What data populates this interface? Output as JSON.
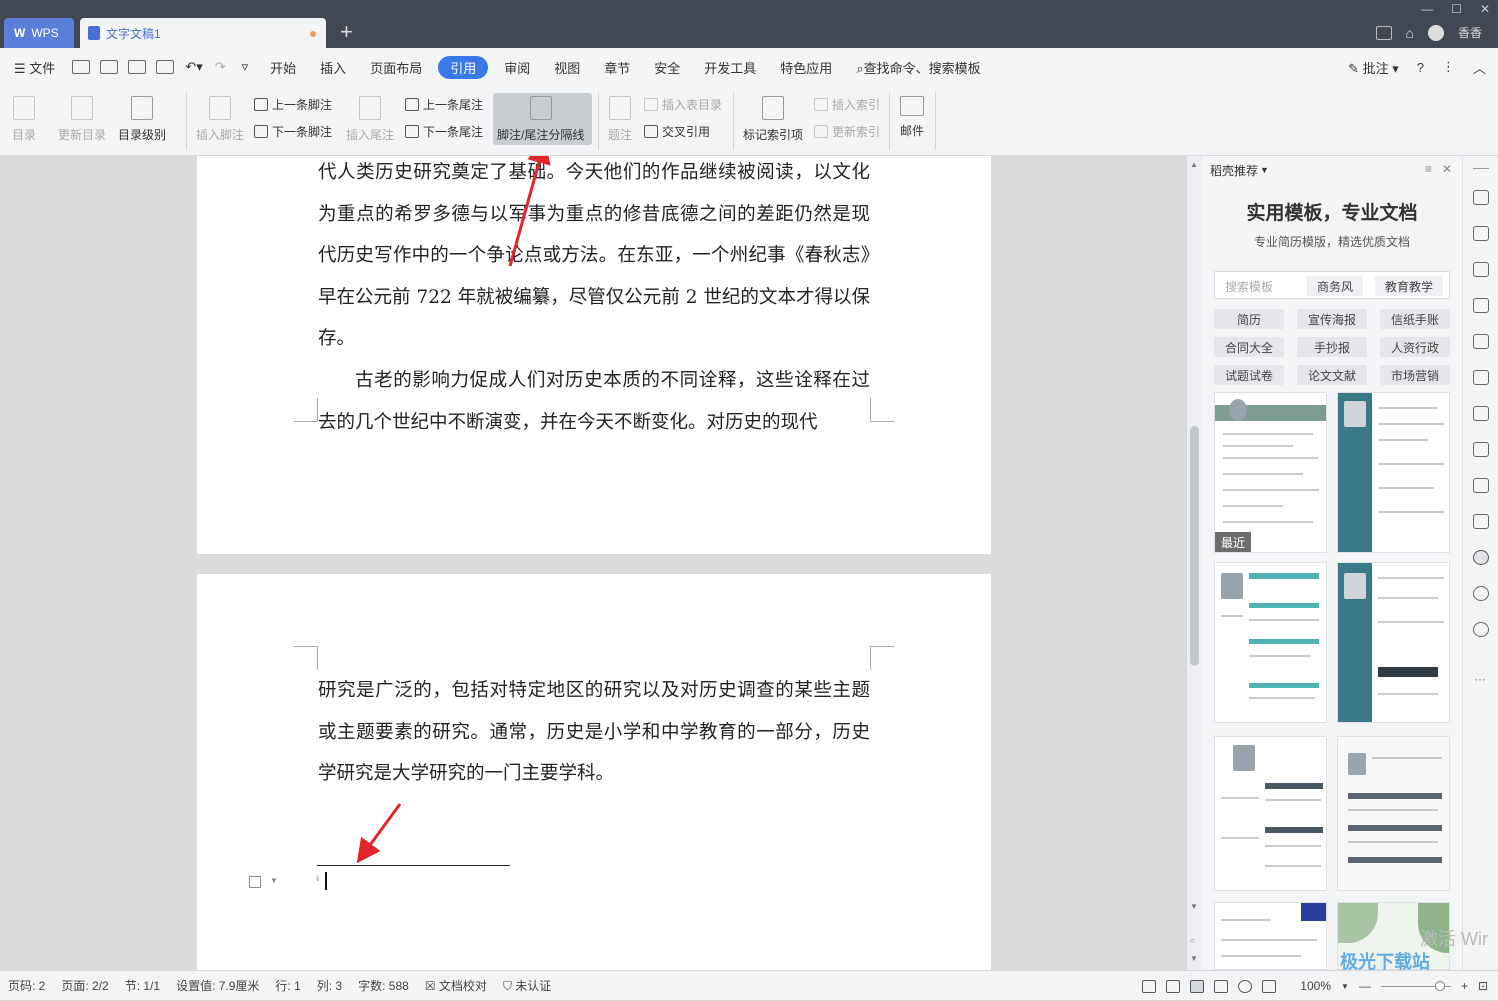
{
  "titlebar": {
    "wps_label": "WPS",
    "doc_tab": "文字文稿1",
    "new_tab": "+",
    "user_name": "香香"
  },
  "menubar": {
    "file": "文件",
    "items": [
      "开始",
      "插入",
      "页面布局",
      "引用",
      "审阅",
      "视图",
      "章节",
      "安全",
      "开发工具",
      "特色应用"
    ],
    "active": "引用",
    "search": "查找命令、搜索模板",
    "annotate": "批注",
    "help": "?"
  },
  "ribbon": {
    "toc": "目录",
    "update_toc": "更新目录",
    "toc_level": "目录级别",
    "insert_footnote": "插入脚注",
    "prev_footnote": "上一条脚注",
    "next_footnote": "下一条脚注",
    "insert_endnote": "插入尾注",
    "prev_endnote": "上一条尾注",
    "next_endnote": "下一条尾注",
    "separator": "脚注/尾注分隔线",
    "caption": "题注",
    "insert_table_of_figures": "插入表目录",
    "cross_ref": "交叉引用",
    "mark_index": "标记索引项",
    "insert_index": "插入索引",
    "update_index": "更新索引",
    "mail": "邮件"
  },
  "document": {
    "page1_paragraphs": [
      "代人类历史研究奠定了基础。今天他们的作品继续被阅读，以文化为重点的希罗多德与以军事为重点的修昔底德之间的差距仍然是现代历史写作中的一个争论点或方法。在东亚，一个州纪事《春秋志》早在公元前 722 年就被编纂，尽管仅公元前 2 世纪的文本才得以保存。",
      "古老的影响力促成人们对历史本质的不同诠释，这些诠释在过去的几个世纪中不断演变，并在今天不断变化。对历史的现代"
    ],
    "page2_paragraphs": [
      "研究是广泛的，包括对特定地区的研究以及对历史调查的某些主题或主题要素的研究。通常，历史是小学和中学教育的一部分，历史学研究是大学研究的一门主要学科。"
    ],
    "footnote_mark": "i"
  },
  "panel": {
    "title": "稻壳推荐",
    "heading": "实用模板，专业文档",
    "subheading": "专业简历模版，精选优质文档",
    "search_placeholder": "搜索模板",
    "search_tags": [
      "商务风",
      "教育教学"
    ],
    "categories": [
      "简历",
      "宣传海报",
      "信纸手账",
      "合同大全",
      "手抄报",
      "人资行政",
      "试题试卷",
      "论文文献",
      "市场营销"
    ],
    "recent_label": "最近"
  },
  "statusbar": {
    "page_num": "页码: 2",
    "pages": "页面: 2/2",
    "section": "节: 1/1",
    "setting": "设置值: 7.9厘米",
    "row": "行: 1",
    "col": "列: 3",
    "words": "字数: 588",
    "proof": "文档校对",
    "cert": "未认证",
    "zoom": "100%"
  },
  "watermark": {
    "activate_windows": "激活 Wir",
    "site": "极光下载站"
  },
  "colors": {
    "titlebar": "#424754",
    "active_tab": "#3b78e7",
    "annotation_arrow": "#e0262b",
    "resume_teal": "#3a7a86"
  }
}
